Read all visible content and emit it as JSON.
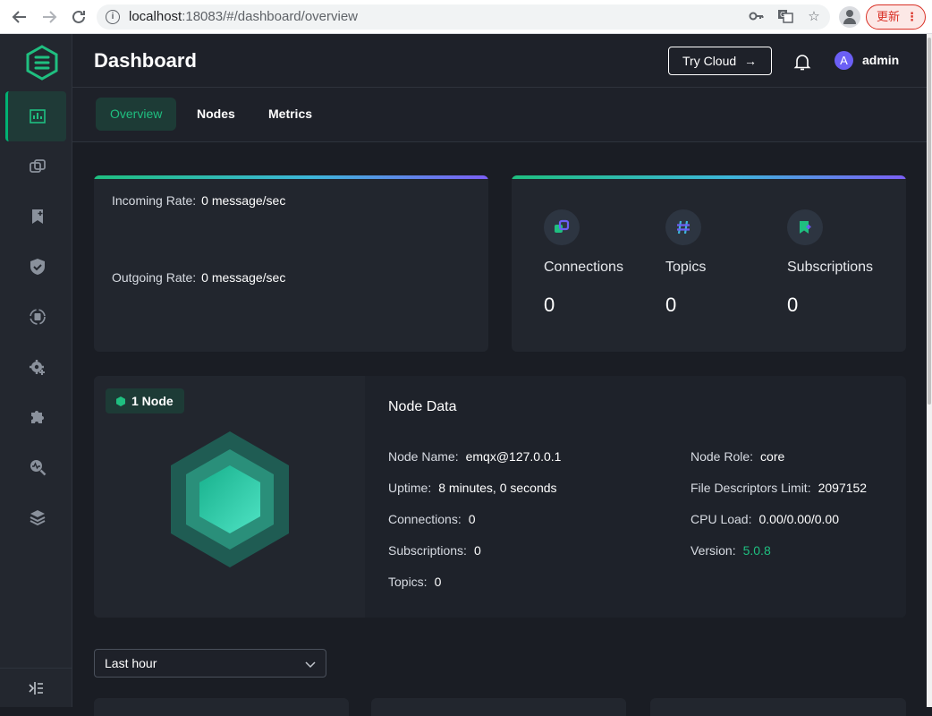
{
  "browser": {
    "url_host": "localhost",
    "url_rest": ":18083/#/dashboard/overview",
    "update_label": "更新"
  },
  "header": {
    "title": "Dashboard",
    "try_cloud": "Try Cloud",
    "avatar_letter": "A",
    "username": "admin"
  },
  "tabs": [
    {
      "label": "Overview",
      "active": true
    },
    {
      "label": "Nodes",
      "active": false
    },
    {
      "label": "Metrics",
      "active": false
    }
  ],
  "rates": {
    "incoming_label": "Incoming Rate:",
    "incoming_value": "0 message/sec",
    "outgoing_label": "Outgoing Rate:",
    "outgoing_value": "0 message/sec"
  },
  "stats": [
    {
      "label": "Connections",
      "value": "0",
      "icon": "connections-icon"
    },
    {
      "label": "Topics",
      "value": "0",
      "icon": "hash-icon"
    },
    {
      "label": "Subscriptions",
      "value": "0",
      "icon": "subscriptions-icon"
    }
  ],
  "node": {
    "badge": "1 Node",
    "data_title": "Node Data",
    "left_fields": [
      {
        "label": "Node Name:",
        "value": "emqx@127.0.0.1"
      },
      {
        "label": "Uptime:",
        "value": "8 minutes, 0 seconds"
      },
      {
        "label": "Connections:",
        "value": "0"
      },
      {
        "label": "Subscriptions:",
        "value": "0"
      },
      {
        "label": "Topics:",
        "value": "0"
      }
    ],
    "right_fields": [
      {
        "label": "Node Role:",
        "value": "core"
      },
      {
        "label": "File Descriptors Limit:",
        "value": "2097152"
      },
      {
        "label": "CPU Load:",
        "value": "0.00/0.00/0.00"
      },
      {
        "label": "Version:",
        "value": "5.0.8"
      }
    ]
  },
  "time_range": {
    "selected": "Last hour"
  },
  "colors": {
    "accent": "#1fbf80",
    "version": "#1fbf80",
    "avatar": "#6b5ff5"
  }
}
